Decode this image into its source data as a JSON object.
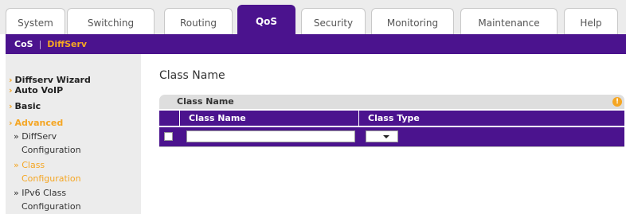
{
  "tabs": [
    {
      "label": "System",
      "active": false
    },
    {
      "label": "Switching",
      "active": false
    },
    {
      "label": "Routing",
      "active": false
    },
    {
      "label": "QoS",
      "active": true
    },
    {
      "label": "Security",
      "active": false
    },
    {
      "label": "Monitoring",
      "active": false
    },
    {
      "label": "Maintenance",
      "active": false
    },
    {
      "label": "Help",
      "active": false
    }
  ],
  "subnav": {
    "items": [
      {
        "label": "CoS",
        "current": false
      },
      {
        "label": "DiffServ",
        "current": true
      }
    ],
    "separator": "|"
  },
  "leftnav": {
    "items": [
      {
        "label": "Diffserv Wizard",
        "level": "top",
        "active": false
      },
      {
        "label": "Auto VoIP",
        "level": "top",
        "active": false
      },
      {
        "label": "Basic",
        "level": "top",
        "active": false
      },
      {
        "label": "Advanced",
        "level": "top",
        "active": true
      },
      {
        "label": "» DiffServ",
        "level": "sub",
        "active": false
      },
      {
        "label": "Configuration",
        "level": "sub",
        "active": false
      },
      {
        "label": "» Class",
        "level": "sub",
        "active": true
      },
      {
        "label": "Configuration",
        "level": "sub",
        "active": true
      },
      {
        "label": "» IPv6 Class",
        "level": "sub",
        "active": false
      },
      {
        "label": "Configuration",
        "level": "sub",
        "active": false
      }
    ]
  },
  "main": {
    "page_title": "Class Name",
    "panel_title": "Class Name",
    "help_icon": "help-icon",
    "columns": [
      "Class Name",
      "Class Type"
    ],
    "row": {
      "class_name_value": "",
      "class_type_value": "",
      "checked": false
    }
  },
  "colors": {
    "accent": "#4b138e",
    "highlight": "#f5a623",
    "nav_background": "#ececec"
  }
}
